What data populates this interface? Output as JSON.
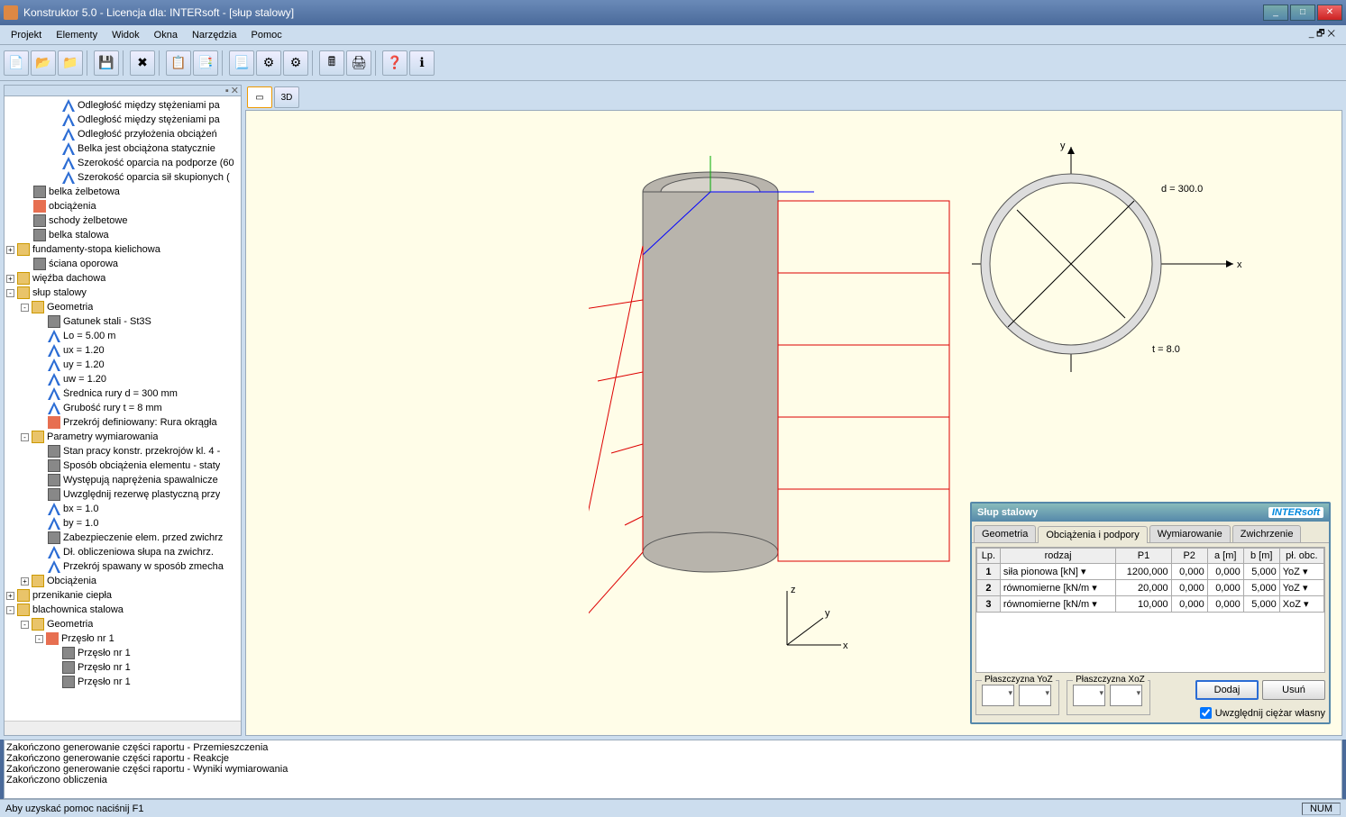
{
  "window": {
    "title": "Konstruktor 5.0 - Licencja dla: INTERsoft - [słup stalowy]"
  },
  "menu": {
    "projekt": "Projekt",
    "elementy": "Elementy",
    "widok": "Widok",
    "okna": "Okna",
    "narzedzia": "Narzędzia",
    "pomoc": "Pomoc"
  },
  "view": {
    "btn3d": "3D"
  },
  "tree": {
    "items": [
      {
        "d": 3,
        "i": "a",
        "l": "Odległość między stężeniami pa"
      },
      {
        "d": 3,
        "i": "a",
        "l": "Odległość między stężeniami pa"
      },
      {
        "d": 3,
        "i": "a",
        "l": "Odległość przyłożenia obciążeń"
      },
      {
        "d": 3,
        "i": "a",
        "l": "Belka jest obciążona statycznie"
      },
      {
        "d": 3,
        "i": "a",
        "l": "Szerokość oparcia na podporze (60"
      },
      {
        "d": 3,
        "i": "a",
        "l": "Szerokość oparcia sił skupionych ("
      },
      {
        "d": 1,
        "i": "g",
        "l": "belka żelbetowa"
      },
      {
        "d": 1,
        "i": "p",
        "l": "obciążenia"
      },
      {
        "d": 1,
        "i": "g",
        "l": "schody żelbetowe"
      },
      {
        "d": 1,
        "i": "g",
        "l": "belka stalowa"
      },
      {
        "d": 0,
        "e": "+",
        "i": "f",
        "l": "fundamenty-stopa kielichowa"
      },
      {
        "d": 1,
        "i": "g",
        "l": "ściana oporowa"
      },
      {
        "d": 0,
        "e": "+",
        "i": "f",
        "l": "więźba dachowa"
      },
      {
        "d": 0,
        "e": "-",
        "i": "f",
        "l": "słup stalowy"
      },
      {
        "d": 1,
        "e": "-",
        "i": "f",
        "l": "Geometria"
      },
      {
        "d": 2,
        "i": "g",
        "l": "Gatunek stali - St3S"
      },
      {
        "d": 2,
        "i": "a",
        "l": "Lo = 5.00 m"
      },
      {
        "d": 2,
        "i": "a",
        "l": "ux = 1.20"
      },
      {
        "d": 2,
        "i": "a",
        "l": "uy = 1.20"
      },
      {
        "d": 2,
        "i": "a",
        "l": "uw = 1.20"
      },
      {
        "d": 2,
        "i": "a",
        "l": "Średnica rury d = 300 mm"
      },
      {
        "d": 2,
        "i": "a",
        "l": "Grubość rury t = 8 mm"
      },
      {
        "d": 2,
        "i": "p",
        "l": "Przekrój definiowany: Rura okrągła"
      },
      {
        "d": 1,
        "e": "-",
        "i": "f",
        "l": "Parametry wymiarowania"
      },
      {
        "d": 2,
        "i": "g",
        "l": "Stan pracy konstr. przekrojów kl. 4 -"
      },
      {
        "d": 2,
        "i": "g",
        "l": "Sposób obciążenia elementu - staty"
      },
      {
        "d": 2,
        "i": "g",
        "l": "Występują naprężenia spawalnicze"
      },
      {
        "d": 2,
        "i": "g",
        "l": "Uwzględnij rezerwę plastyczną przy"
      },
      {
        "d": 2,
        "i": "a",
        "l": "bx = 1.0"
      },
      {
        "d": 2,
        "i": "a",
        "l": "by = 1.0"
      },
      {
        "d": 2,
        "i": "g",
        "l": "Zabezpieczenie elem. przed zwichrz"
      },
      {
        "d": 2,
        "i": "a",
        "l": "Dł. obliczeniowa słupa na zwichrz."
      },
      {
        "d": 2,
        "i": "a",
        "l": "Przekrój spawany w sposób zmecha"
      },
      {
        "d": 1,
        "e": "+",
        "i": "f",
        "l": "Obciążenia"
      },
      {
        "d": 0,
        "e": "+",
        "i": "f",
        "l": "przenikanie ciepła"
      },
      {
        "d": 0,
        "e": "-",
        "i": "f",
        "l": "blachownica stalowa"
      },
      {
        "d": 1,
        "e": "-",
        "i": "f",
        "l": "Geometria"
      },
      {
        "d": 2,
        "e": "-",
        "i": "p",
        "l": "Przęsło nr 1"
      },
      {
        "d": 3,
        "i": "g",
        "l": "Przęsło nr 1"
      },
      {
        "d": 3,
        "i": "g",
        "l": "Przęsło nr 1"
      },
      {
        "d": 3,
        "i": "g",
        "l": "Przęsło nr 1"
      }
    ]
  },
  "section_labels": {
    "d": "d = 300.0",
    "t": "t = 8.0",
    "x": "x",
    "y": "y"
  },
  "axes3d": {
    "x": "x",
    "y": "y",
    "z": "z"
  },
  "panel": {
    "title": "Słup stalowy",
    "brand": "INTERsoft",
    "tabs": {
      "geom": "Geometria",
      "obc": "Obciążenia i podpory",
      "wym": "Wymiarowanie",
      "zw": "Zwichrzenie"
    },
    "headers": {
      "lp": "Lp.",
      "rodzaj": "rodzaj",
      "p1": "P1",
      "p2": "P2",
      "a": "a [m]",
      "b": "b [m]",
      "pl": "pł. obc."
    },
    "rows": [
      {
        "lp": "1",
        "rodzaj": "siła pionowa [kN]",
        "p1": "1200,000",
        "p2": "0,000",
        "a": "0,000",
        "b": "5,000",
        "pl": "YoZ"
      },
      {
        "lp": "2",
        "rodzaj": "równomierne [kN/m",
        "p1": "20,000",
        "p2": "0,000",
        "a": "0,000",
        "b": "5,000",
        "pl": "YoZ"
      },
      {
        "lp": "3",
        "rodzaj": "równomierne [kN/m",
        "p1": "10,000",
        "p2": "0,000",
        "a": "0,000",
        "b": "5,000",
        "pl": "XoZ"
      }
    ],
    "yoz": "Płaszczyzna YoZ",
    "xoz": "Płaszczyzna XoZ",
    "dodaj": "Dodaj",
    "usun": "Usuń",
    "chk": "Uwzględnij ciężar własny"
  },
  "log": {
    "l1": "Zakończono generowanie części raportu - Przemieszczenia",
    "l2": "Zakończono generowanie części raportu - Reakcje",
    "l3": "Zakończono generowanie części raportu - Wyniki wymiarowania",
    "l4": "Zakończono obliczenia"
  },
  "status": {
    "help": "Aby uzyskać pomoc naciśnij F1",
    "num": "NUM"
  }
}
